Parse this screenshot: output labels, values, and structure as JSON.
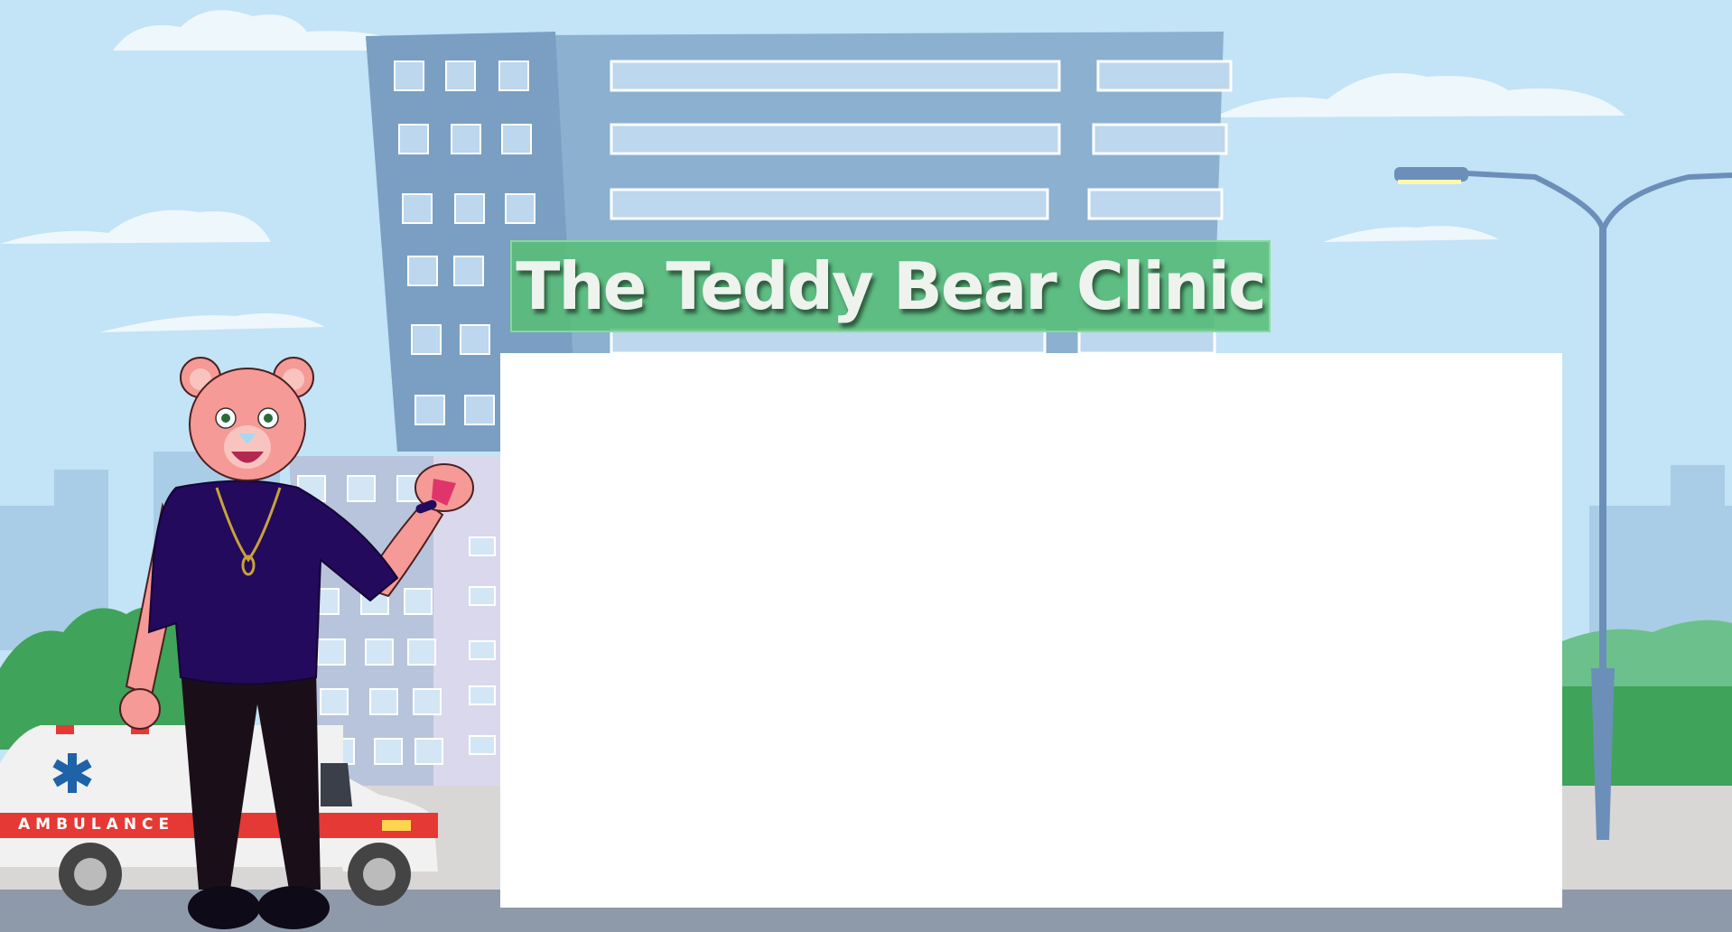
{
  "title": "The Teddy Bear Clinic",
  "ambulance_label": "AMBULANCE",
  "colors": {
    "sky": "#c3e3f6",
    "banner": "#58be78",
    "building": "#8bb0d0",
    "bear_fur": "#f59a96",
    "bear_top": "#230a5c",
    "ambulance_stripe": "#e53935",
    "ambulance_star": "#1e63a8"
  },
  "icons": [
    "cloud-icon",
    "star-of-life-icon",
    "street-lamp-icon"
  ]
}
